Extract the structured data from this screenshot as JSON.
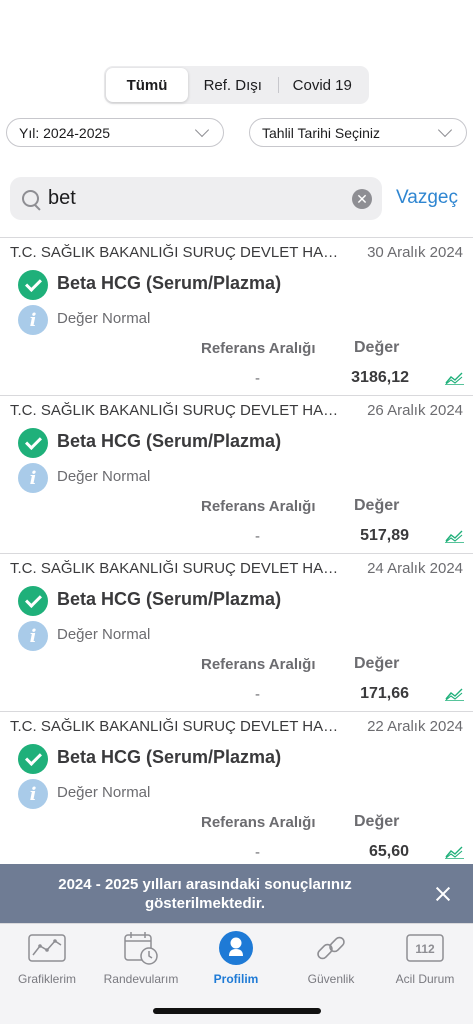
{
  "segments": [
    {
      "label": "Tümü",
      "active": true
    },
    {
      "label": "Ref. Dışı",
      "active": false
    },
    {
      "label": "Covid 19",
      "active": false
    }
  ],
  "filters": {
    "year_label": "Yıl: 2024-2025",
    "date_label": "Tahlil Tarihi Seçiniz"
  },
  "search": {
    "value": "bet",
    "cancel_label": "Vazgeç"
  },
  "column_headers": {
    "reference": "Referans Aralığı",
    "value": "Değer"
  },
  "results": [
    {
      "hospital": "T.C. SAĞLIK BAKANLIĞI SURUÇ DEVLET HASTANESİ",
      "date": "30 Aralık 2024",
      "test": "Beta HCG (Serum/Plazma)",
      "status": "Değer Normal",
      "reference": "-",
      "value": "3186,12"
    },
    {
      "hospital": "T.C. SAĞLIK BAKANLIĞI SURUÇ DEVLET HASTANESİ",
      "date": "26 Aralık 2024",
      "test": "Beta HCG (Serum/Plazma)",
      "status": "Değer Normal",
      "reference": "-",
      "value": "517,89"
    },
    {
      "hospital": "T.C. SAĞLIK BAKANLIĞI SURUÇ DEVLET HASTANESİ",
      "date": "24 Aralık 2024",
      "test": "Beta HCG (Serum/Plazma)",
      "status": "Değer Normal",
      "reference": "-",
      "value": "171,66"
    },
    {
      "hospital": "T.C. SAĞLIK BAKANLIĞI SURUÇ DEVLET HASTANESİ",
      "date": "22 Aralık 2024",
      "test": "Beta HCG (Serum/Plazma)",
      "status": "Değer Normal",
      "reference": "-",
      "value": "65,60"
    }
  ],
  "toast": {
    "message": "2024 - 2025 yılları arasındaki sonuçlarınız gösterilmektedir."
  },
  "tabbar": [
    {
      "label": "Grafiklerim",
      "icon": "chart-icon",
      "active": false
    },
    {
      "label": "Randevularım",
      "icon": "calendar-icon",
      "active": false
    },
    {
      "label": "Profilim",
      "icon": "profile-icon",
      "active": true
    },
    {
      "label": "Güvenlik",
      "icon": "link-icon",
      "active": false
    },
    {
      "label": "Acil Durum",
      "icon": "emergency-112-icon",
      "badge": "112",
      "active": false
    }
  ],
  "colors": {
    "accent": "#1e7ad6",
    "link": "#2f86d1",
    "success": "#1fb07a",
    "info": "#a9cbe9",
    "toast_bg": "#6f7c94"
  }
}
